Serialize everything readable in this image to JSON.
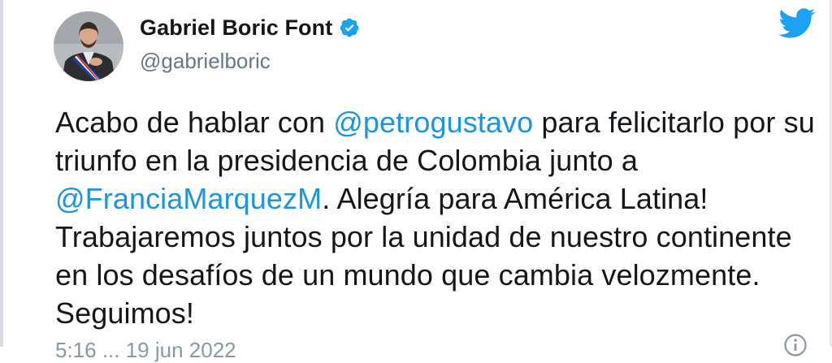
{
  "author": {
    "display_name": "Gabriel Boric Font",
    "handle": "@gabrielboric",
    "verified": true
  },
  "icons": {
    "verified": "verified-badge-icon",
    "brand": "twitter-bird-icon",
    "info": "info-icon"
  },
  "tweet": {
    "segments": [
      {
        "type": "text",
        "value": "Acabo de hablar con "
      },
      {
        "type": "mention",
        "value": "@petrogustavo"
      },
      {
        "type": "text",
        "value": " para felicitarlo por su triunfo en la presidencia de Colombia junto a "
      },
      {
        "type": "mention",
        "value": "@FranciaMarquezM"
      },
      {
        "type": "text",
        "value": ". Alegría para América Latina! Trabajaremos juntos por la unidad de nuestro continente en los desafíos de un mundo que cambia velozmente. Seguimos!"
      }
    ]
  },
  "meta": {
    "timestamp": "5:16 ... 19 jun 2022"
  },
  "colors": {
    "text": "#14171a",
    "secondary": "#657786",
    "link": "#1b95e0",
    "brand": "#1da1f2"
  }
}
